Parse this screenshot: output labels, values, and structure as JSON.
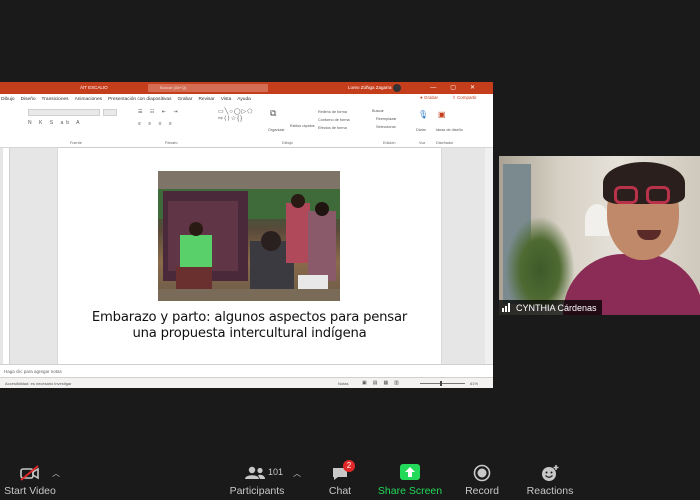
{
  "powerpoint": {
    "title_bar": {
      "filename": "ÁIT ESCALIO",
      "search_placeholder": "Buscar (Alt+Q)",
      "user_name": "Loreo Zúñiga Zagarra"
    },
    "menu_tabs": [
      "Dibujo",
      "Diseño",
      "Transiciones",
      "Animaciones",
      "Presentación con diapositivas",
      "Grabar",
      "Revisar",
      "Vista",
      "Ayuda"
    ],
    "grabar_button": "Grabar",
    "share_button": "Compartir",
    "ribbon": {
      "groups": [
        "Fuente",
        "Párrafo",
        "Dibujo",
        "Edición",
        "Voz",
        "Diseñador"
      ],
      "organize": "Organizar",
      "quick_styles": "Estilos rápidos",
      "shape_fill": "Relleno de forma",
      "shape_outline": "Contorno de forma",
      "shape_effects": "Efectos de forma",
      "find": "Buscar",
      "replace": "Reemplazar",
      "select": "Seleccionar",
      "dictate": "Dictar",
      "design_ideas": "Ideas de diseño"
    },
    "slide": {
      "title_line1": "Embarazo y parto: algunos aspectos para pensar",
      "title_line2": "una propuesta intercultural indígena"
    },
    "notes_placeholder": "Haga clic para agregar notas",
    "status": {
      "accessibility": "Accesibilidad: es necesario investigar",
      "notes": "Notas",
      "zoom": "61%"
    }
  },
  "participant_video": {
    "name": "CYNTHIA Cárdenas"
  },
  "toolbar": {
    "start_video": "Start Video",
    "participants": "Participants",
    "participants_count": "101",
    "chat": "Chat",
    "chat_badge": "2",
    "share_screen": "Share Screen",
    "record": "Record",
    "reactions": "Reactions"
  },
  "colors": {
    "ppt_accent": "#c43e1c",
    "share_green": "#23d959",
    "badge_red": "#e02828",
    "background": "#1a1a1a"
  }
}
